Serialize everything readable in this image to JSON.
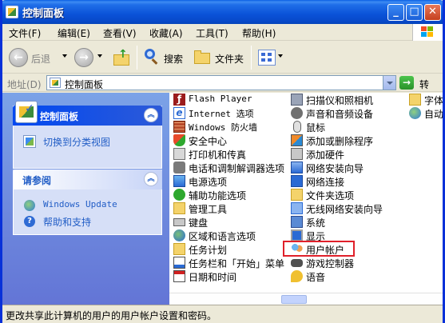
{
  "window": {
    "title": "控制面板"
  },
  "menu": [
    "文件(F)",
    "编辑(E)",
    "查看(V)",
    "收藏(A)",
    "工具(T)",
    "帮助(H)"
  ],
  "toolbar": {
    "back": "后退",
    "search": "搜索",
    "folders": "文件夹"
  },
  "address": {
    "label": "地址(D)",
    "value": "控制面板",
    "go": "转到"
  },
  "left": {
    "panel1": {
      "title": "控制面板",
      "links": [
        "切换到分类视图"
      ]
    },
    "panel2": {
      "title": "请参阅",
      "links": [
        "Windows Update",
        "帮助和支持"
      ]
    }
  },
  "items": {
    "col1": [
      "Flash Player",
      "Internet 选项",
      "Windows 防火墙",
      "安全中心",
      "打印机和传真",
      "电话和调制解调器选项",
      "电源选项",
      "辅助功能选项",
      "管理工具",
      "键盘",
      "区域和语言选项",
      "任务计划",
      "任务栏和「开始」菜单",
      "日期和时间"
    ],
    "col2": [
      "扫描仪和照相机",
      "声音和音频设备",
      "鼠标",
      "添加或删除程序",
      "添加硬件",
      "网络安装向导",
      "网络连接",
      "文件夹选项",
      "无线网络安装向导",
      "系统",
      "显示",
      "用户帐户",
      "游戏控制器",
      "语音"
    ],
    "col3": [
      "字体",
      "自动更"
    ]
  },
  "status": "更改共享此计算机的用户的用户帐户设置和密码。"
}
